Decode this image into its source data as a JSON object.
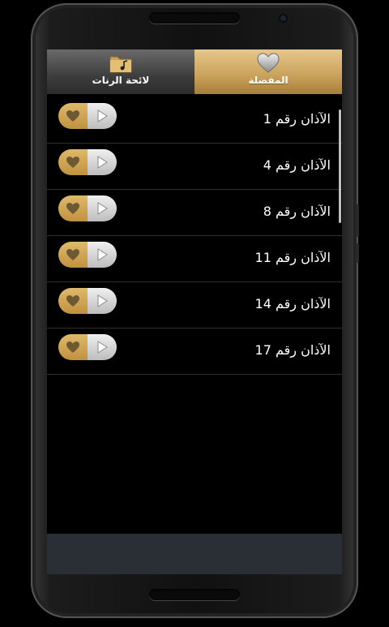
{
  "tabs": {
    "playlist": {
      "label": "لائحة الرنات",
      "icon": "music-folder-icon"
    },
    "favorites": {
      "label": "المفضلة",
      "icon": "heart-icon",
      "active": true
    }
  },
  "favorites_list": [
    {
      "title": "الآذان رقم 1"
    },
    {
      "title": "الآذان رقم 4"
    },
    {
      "title": "الآذان رقم 8"
    },
    {
      "title": "الآذان رقم 11"
    },
    {
      "title": "الآذان رقم 14"
    },
    {
      "title": "الآذان رقم 17"
    }
  ],
  "colors": {
    "accent_gold": "#c9a15a",
    "background": "#000000",
    "bottom_bar": "#2a2f35"
  }
}
